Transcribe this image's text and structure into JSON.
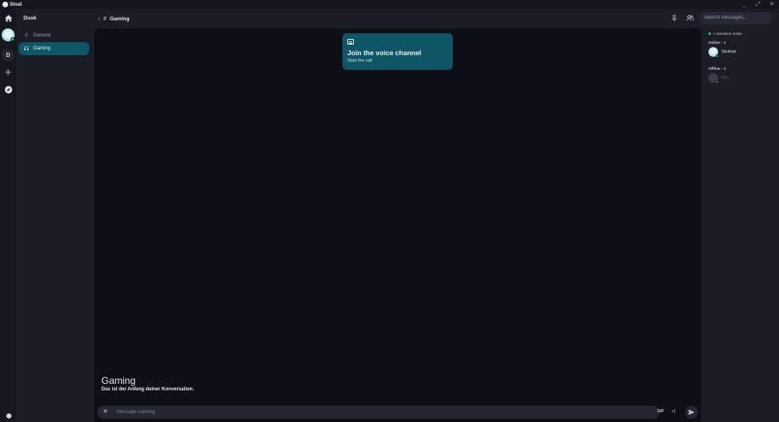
{
  "app": {
    "name": "Stoat",
    "window_controls": [
      "_",
      "⤢",
      "✕"
    ]
  },
  "rail": {
    "server_initial": "D",
    "icons": [
      "home-icon",
      "add-server-icon",
      "explore-icon",
      "settings-icon"
    ]
  },
  "sidebar": {
    "server_name": "Dusk",
    "channels": [
      {
        "label": "General",
        "type": "text",
        "icon": "#"
      },
      {
        "label": "Gaming",
        "type": "voice",
        "icon": "🎧",
        "active": true
      }
    ]
  },
  "header": {
    "back": "‹",
    "hash": "#",
    "channel_title": "Gaming"
  },
  "search": {
    "placeholder": "Search messages..."
  },
  "voice_card": {
    "title": "Join the voice channel",
    "subtitle": "Start the call"
  },
  "welcome": {
    "title": "Gaming",
    "subtitle": "Das ist der Anfang deiner Konversation."
  },
  "composer": {
    "placeholder": "Message Gaming",
    "gif_label": "GIF",
    "skip_label": "▹|"
  },
  "members": {
    "online_count": "1 members online",
    "online_label": "Online – 1",
    "offline_label": "Offline – 1",
    "online_members": [
      {
        "name": "Sicknor",
        "status_color": "#2ecc71",
        "name_color": "#e7e9ee"
      }
    ],
    "offline_members": [
      {
        "name": "Kyo",
        "status_color": "#8a8f9c",
        "name_color": "#5b606d"
      }
    ]
  },
  "colors": {
    "accent": "#0e5566",
    "online": "#2ecc71",
    "chat_bg": "#0d0f16",
    "sidebar_bg": "#1b1d26"
  }
}
